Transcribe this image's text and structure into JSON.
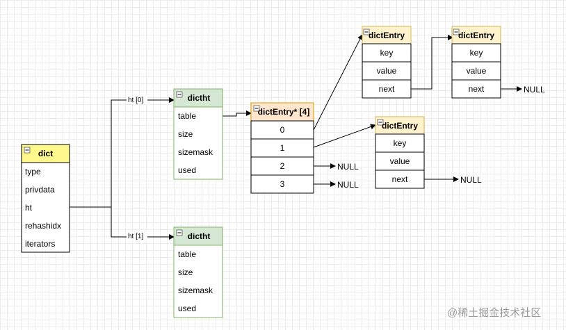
{
  "nodes": {
    "dict": {
      "title": "dict",
      "fields": [
        "type",
        "privdata",
        "ht",
        "rehashidx",
        "iterators"
      ]
    },
    "dictht0": {
      "title": "dictht",
      "fields": [
        "table",
        "size",
        "sizemask",
        "used"
      ]
    },
    "dictht1": {
      "title": "dictht",
      "fields": [
        "table",
        "size",
        "sizemask",
        "used"
      ]
    },
    "entry_array": {
      "title": "dictEntry* [4]",
      "fields": [
        "0",
        "1",
        "2",
        "3"
      ]
    },
    "entry_a": {
      "title": "dictEntry",
      "fields": [
        "key",
        "value",
        "next"
      ]
    },
    "entry_b": {
      "title": "dictEntry",
      "fields": [
        "key",
        "value",
        "next"
      ]
    },
    "entry_c": {
      "title": "dictEntry",
      "fields": [
        "key",
        "value",
        "next"
      ]
    }
  },
  "edges": {
    "ht0_label": "ht [0]",
    "ht1_label": "ht [1]",
    "null": "NULL"
  },
  "colors": {
    "dict_header": "#fff88c",
    "dictht_header": "#d5e8d4",
    "dictht_border": "#82b366",
    "entry_header": "#ffe6cc",
    "entry_border": "#d79b00",
    "entry_single_header": "#fff2cc",
    "entry_single_border": "#d6b656"
  },
  "watermark": "@稀土掘金技术社区"
}
